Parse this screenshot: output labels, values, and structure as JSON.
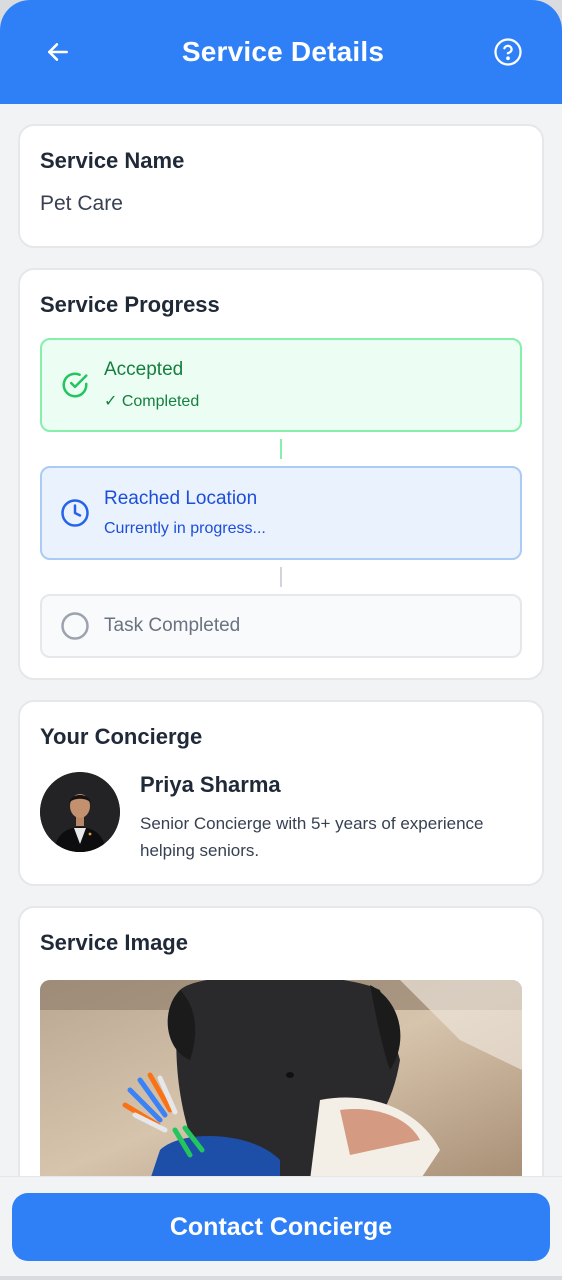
{
  "header": {
    "title": "Service Details",
    "back_icon": "arrow-left-icon",
    "help_icon": "help-circle-icon"
  },
  "service_name_card": {
    "title": "Service Name",
    "value": "Pet Care"
  },
  "progress_card": {
    "title": "Service Progress",
    "steps": [
      {
        "title": "Accepted",
        "subtitle": "✓ Completed",
        "status": "done",
        "icon": "check-circle-icon"
      },
      {
        "title": "Reached Location",
        "subtitle": "Currently in progress...",
        "status": "active",
        "icon": "clock-icon"
      },
      {
        "title": "Task Completed",
        "subtitle": "",
        "status": "pending",
        "icon": "empty-circle-icon"
      }
    ]
  },
  "concierge_card": {
    "title": "Your Concierge",
    "name": "Priya Sharma",
    "bio": "Senior Concierge with 5+ years of experience helping seniors."
  },
  "image_card": {
    "title": "Service Image"
  },
  "footer": {
    "contact_label": "Contact Concierge"
  },
  "colors": {
    "primary": "#2f80f7",
    "success": "#15803d",
    "active": "#1d4ed8",
    "pending": "#6b7280"
  }
}
